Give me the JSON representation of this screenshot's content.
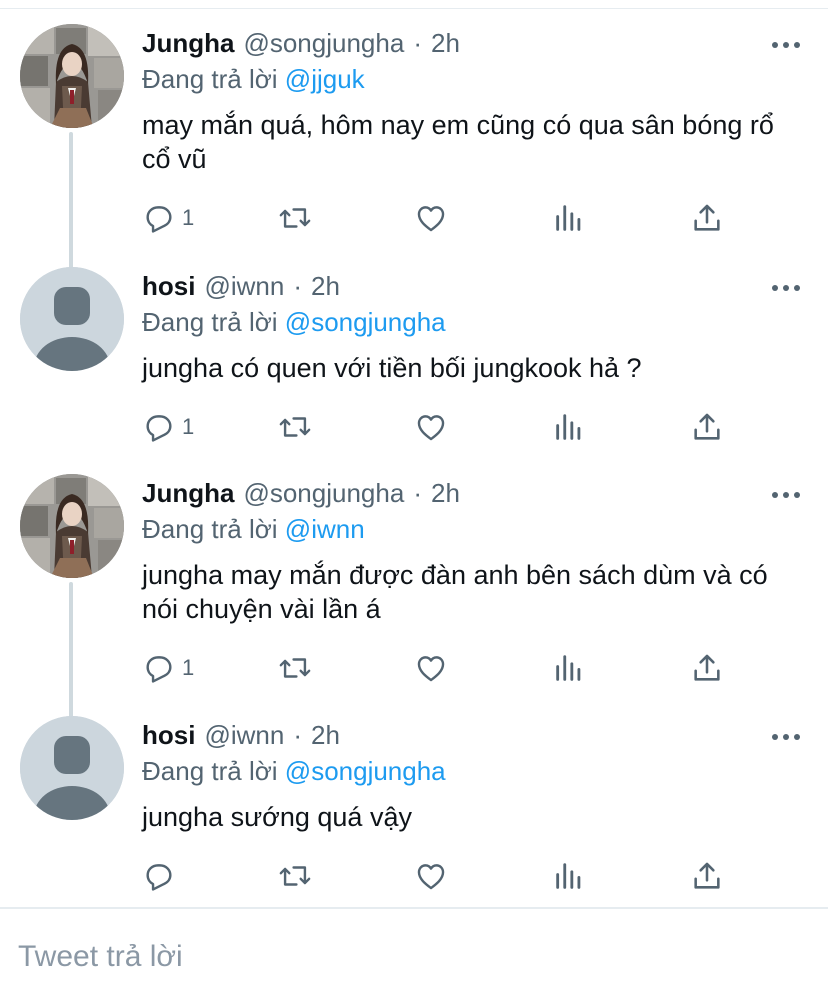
{
  "colors": {
    "link": "#1d9bf0",
    "muted": "#536471",
    "divider": "#e6ecf0",
    "thread_line": "#cfd9de"
  },
  "tweets": [
    {
      "avatar": "profile-photo",
      "name": "Jungha",
      "handle": "@songjungha",
      "separator": "·",
      "time": "2h",
      "reply_prefix": "Đang trả lời",
      "reply_to": "@jjguk",
      "text": "may mắn quá, hôm nay em cũng có qua sân bóng rổ cổ vũ",
      "reply_count": "1"
    },
    {
      "avatar": "default-avatar",
      "name": "hosi",
      "handle": "@iwnn",
      "separator": "·",
      "time": "2h",
      "reply_prefix": "Đang trả lời",
      "reply_to": "@songjungha",
      "text": "jungha có quen với tiền bối jungkook hả ?",
      "reply_count": "1"
    },
    {
      "avatar": "profile-photo",
      "name": "Jungha",
      "handle": "@songjungha",
      "separator": "·",
      "time": "2h",
      "reply_prefix": "Đang trả lời",
      "reply_to": "@iwnn",
      "text": "jungha may mắn được đàn anh bên sách dùm và có nói chuyện vài lần á",
      "reply_count": "1"
    },
    {
      "avatar": "default-avatar",
      "name": "hosi",
      "handle": "@iwnn",
      "separator": "·",
      "time": "2h",
      "reply_prefix": "Đang trả lời",
      "reply_to": "@songjungha",
      "text": "jungha sướng quá vậy",
      "reply_count": ""
    }
  ],
  "icons": [
    "reply-icon",
    "retweet-icon",
    "like-icon",
    "stats-icon",
    "share-icon",
    "more-icon"
  ],
  "compose": {
    "placeholder": "Tweet trả lời"
  }
}
